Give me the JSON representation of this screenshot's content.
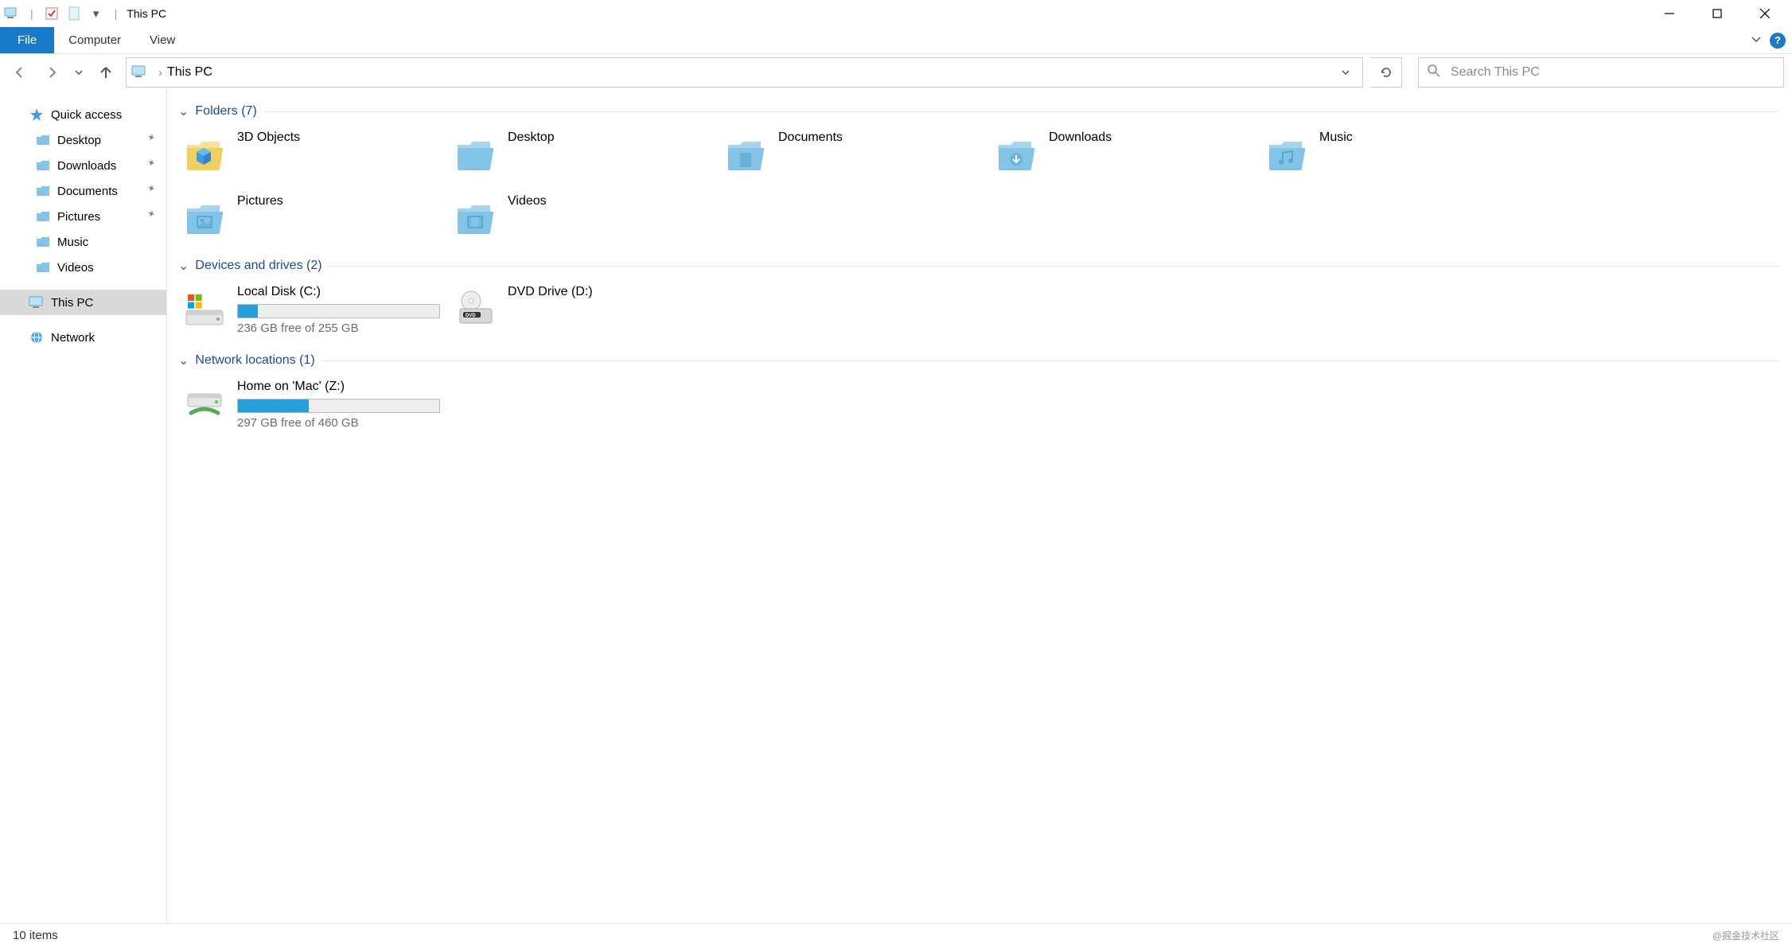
{
  "window": {
    "title": "This PC"
  },
  "ribbon": {
    "file": "File",
    "tabs": [
      "Computer",
      "View"
    ]
  },
  "address": {
    "location": "This PC"
  },
  "search": {
    "placeholder": "Search This PC"
  },
  "sidebar": {
    "quick_access": "Quick access",
    "items": [
      {
        "label": "Desktop",
        "pinned": true
      },
      {
        "label": "Downloads",
        "pinned": true
      },
      {
        "label": "Documents",
        "pinned": true
      },
      {
        "label": "Pictures",
        "pinned": true
      },
      {
        "label": "Music",
        "pinned": false
      },
      {
        "label": "Videos",
        "pinned": false
      }
    ],
    "this_pc": "This PC",
    "network": "Network"
  },
  "groups": {
    "folders": {
      "label": "Folders",
      "count": "(7)"
    },
    "drives": {
      "label": "Devices and drives",
      "count": "(2)"
    },
    "network": {
      "label": "Network locations",
      "count": "(1)"
    }
  },
  "folders": [
    {
      "label": "3D Objects"
    },
    {
      "label": "Desktop"
    },
    {
      "label": "Documents"
    },
    {
      "label": "Downloads"
    },
    {
      "label": "Music"
    },
    {
      "label": "Pictures"
    },
    {
      "label": "Videos"
    }
  ],
  "drives": [
    {
      "name": "Local Disk (C:)",
      "free_text": "236 GB free of 255 GB",
      "used_pct": 10,
      "type": "hdd"
    },
    {
      "name": "DVD Drive (D:)",
      "type": "dvd"
    }
  ],
  "network_locations": [
    {
      "name": "Home on 'Mac' (Z:)",
      "free_text": "297 GB free of 460 GB",
      "used_pct": 35
    }
  ],
  "status": {
    "text": "10 items",
    "watermark": "@掘金技术社区"
  }
}
